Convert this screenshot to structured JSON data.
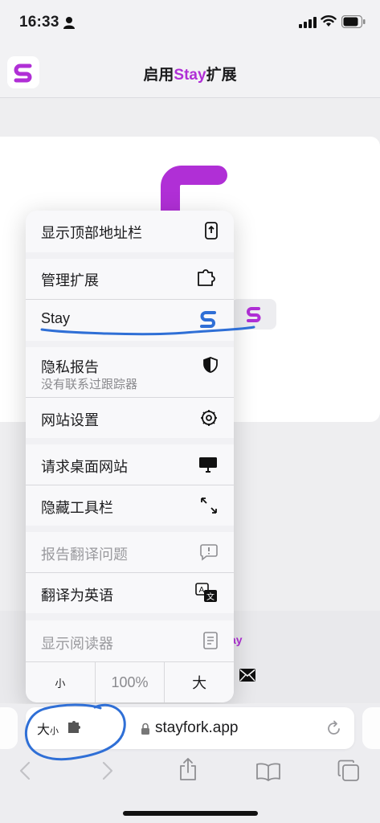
{
  "status_bar": {
    "time": "16:33"
  },
  "header": {
    "title_prefix": "启用",
    "title_brand": "Stay",
    "title_suffix": "扩展"
  },
  "page": {
    "link_fragment": "ay"
  },
  "menu": {
    "items": [
      {
        "label": "显示顶部地址栏",
        "icon": "phone-top-bar-icon"
      },
      {
        "label": "管理扩展",
        "icon": "extension-icon"
      },
      {
        "label": "Stay",
        "icon": "stay-s-icon"
      },
      {
        "label": "隐私报告",
        "sublabel": "没有联系过跟踪器",
        "icon": "shield-icon"
      },
      {
        "label": "网站设置",
        "icon": "gear-icon"
      },
      {
        "label": "请求桌面网站",
        "icon": "monitor-icon"
      },
      {
        "label": "隐藏工具栏",
        "icon": "arrows-expand-icon"
      },
      {
        "label": "报告翻译问题",
        "icon": "speech-alert-icon",
        "disabled": true
      },
      {
        "label": "翻译为英语",
        "icon": "translate-icon"
      },
      {
        "label": "显示阅读器",
        "icon": "reader-icon",
        "disabled": true
      }
    ],
    "zoom": {
      "decrease": "小",
      "value": "100%",
      "increase": "大"
    }
  },
  "address_bar": {
    "aa_large": "大",
    "aa_small": "小",
    "url": "stayfork.app"
  },
  "colors": {
    "brand_purple": "#b02fd6",
    "annotation_blue": "#2f6fd6"
  }
}
